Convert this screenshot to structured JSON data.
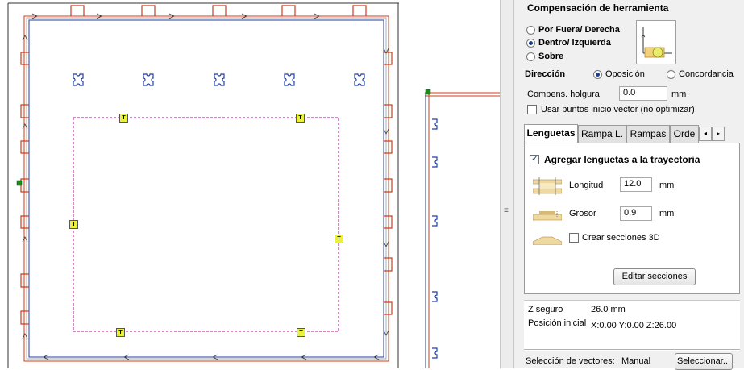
{
  "tool_comp": {
    "title": "Compensación de herramienta",
    "opt_outside": "Por Fuera/ Derecha",
    "opt_inside": "Dentro/ Izquierda",
    "opt_on": "Sobre",
    "selected": "inside"
  },
  "direction": {
    "label": "Dirección",
    "opt_climb": "Oposición",
    "opt_conventional": "Concordancia",
    "selected": "climb"
  },
  "allowance": {
    "label": "Compens. holgura",
    "value": "0.0",
    "unit": "mm"
  },
  "use_vector_start": {
    "label": "Usar puntos inicio vector (no optimizar)",
    "checked": false
  },
  "tabs": {
    "items": [
      "Lenguetas",
      "Rampa L.",
      "Rampas",
      "Orde"
    ],
    "active": "Lenguetas"
  },
  "lenguetas": {
    "add_tabs_label": "Agregar lenguetas a la trayectoria",
    "add_tabs_checked": true,
    "length_label": "Longitud",
    "length_value": "12.0",
    "length_unit": "mm",
    "thickness_label": "Grosor",
    "thickness_value": "0.9",
    "thickness_unit": "mm",
    "create_3d_label": "Crear secciones 3D",
    "create_3d_checked": false,
    "edit_button": "Editar secciones"
  },
  "info": {
    "safe_z_label": "Z seguro",
    "safe_z_value": "26.0 mm",
    "home_label": "Posición inicial",
    "home_value": "X:0.00 Y:0.00 Z:26.00"
  },
  "selection": {
    "label": "Selección de vectores:",
    "mode": "Manual",
    "button": "Seleccionar..."
  },
  "canvas": {
    "tab_marker_glyph": "T",
    "colors": {
      "toolpath": "#d03c1a",
      "vector": "#1f3fa8",
      "selected": "#c0009a",
      "start": "#1a8a1a",
      "marker": "#e8f040"
    }
  }
}
